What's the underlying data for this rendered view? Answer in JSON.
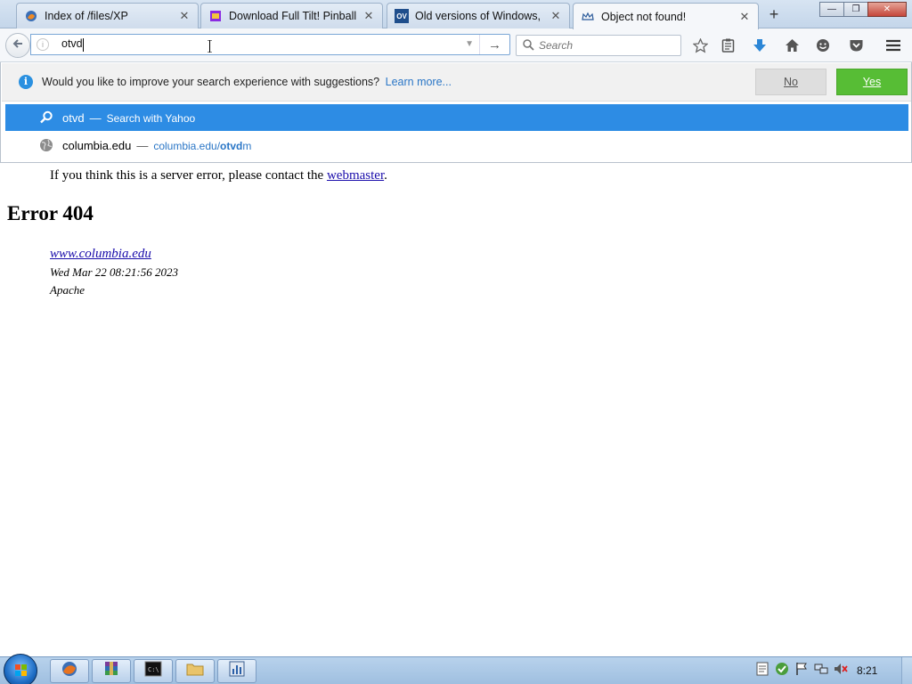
{
  "browser": {
    "tabs": [
      {
        "label": "Index of /files/XP",
        "favicon": "firefox-icon",
        "active": false
      },
      {
        "label": "Download Full Tilt! Pinball ...",
        "favicon": "pinball-icon",
        "active": false
      },
      {
        "label": "Old versions of Windows, ...",
        "favicon": "ov-icon",
        "favicon_text": "OV",
        "active": false
      },
      {
        "label": "Object not found!",
        "favicon": "crown-icon",
        "active": true
      }
    ],
    "new_tab_label": "+",
    "window_buttons": {
      "minimize": "—",
      "maximize": "❐",
      "close": "✕"
    },
    "url_value": "otvd",
    "search_placeholder": "Search"
  },
  "suggestions": {
    "notification": {
      "text": "Would you like to improve your search experience with suggestions?",
      "link": "Learn more...",
      "no_label": "No",
      "yes_label": "Yes"
    },
    "rows": [
      {
        "title": "otvd",
        "sep": "—",
        "subtitle": "Search with Yahoo",
        "icon": "search-icon",
        "selected": true
      },
      {
        "title": "columbia.edu",
        "sep": "—",
        "url_prefix": "columbia.edu/",
        "url_bold": "otvd",
        "url_suffix": "m",
        "icon": "globe-icon",
        "selected": false
      }
    ]
  },
  "page": {
    "line1_text": "If you think this is a server error, please contact the",
    "line1_link": "webmaster",
    "line1_end": ".",
    "heading": "Error 404",
    "address_link": "www.columbia.edu",
    "timestamp": "Wed Mar 22 08:21:56 2023",
    "server": "Apache"
  },
  "taskbar": {
    "clock": "8:21"
  },
  "colors": {
    "selected_row": "#2d8ce4",
    "yes_button": "#57bd35",
    "link": "#1a0dab"
  }
}
